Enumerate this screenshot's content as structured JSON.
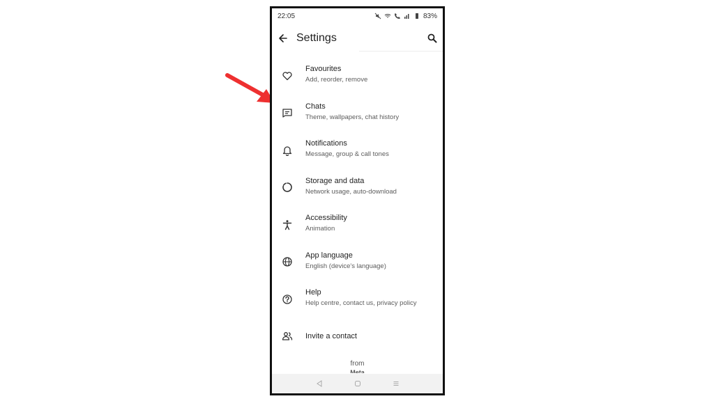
{
  "status_bar": {
    "time": "22:05",
    "battery": "83%"
  },
  "header": {
    "title": "Settings",
    "back_icon": "arrow-left-icon",
    "search_icon": "search-icon"
  },
  "menu": {
    "items": [
      {
        "title": "Favourites",
        "subtitle": "Add, reorder, remove",
        "icon": "heart-icon"
      },
      {
        "title": "Chats",
        "subtitle": "Theme, wallpapers, chat history",
        "icon": "chat-icon"
      },
      {
        "title": "Notifications",
        "subtitle": "Message, group & call tones",
        "icon": "bell-icon"
      },
      {
        "title": "Storage and data",
        "subtitle": "Network usage, auto-download",
        "icon": "storage-icon"
      },
      {
        "title": "Accessibility",
        "subtitle": "Animation",
        "icon": "accessibility-icon"
      },
      {
        "title": "App language",
        "subtitle": "English (device's language)",
        "icon": "globe-icon"
      },
      {
        "title": "Help",
        "subtitle": "Help centre, contact us, privacy policy",
        "icon": "help-icon"
      },
      {
        "title": "Invite a contact",
        "subtitle": "",
        "icon": "people-icon"
      }
    ]
  },
  "footer": {
    "from_label": "from",
    "brand": "Meta"
  },
  "annotation": {
    "arrow_color": "#ee3030"
  }
}
